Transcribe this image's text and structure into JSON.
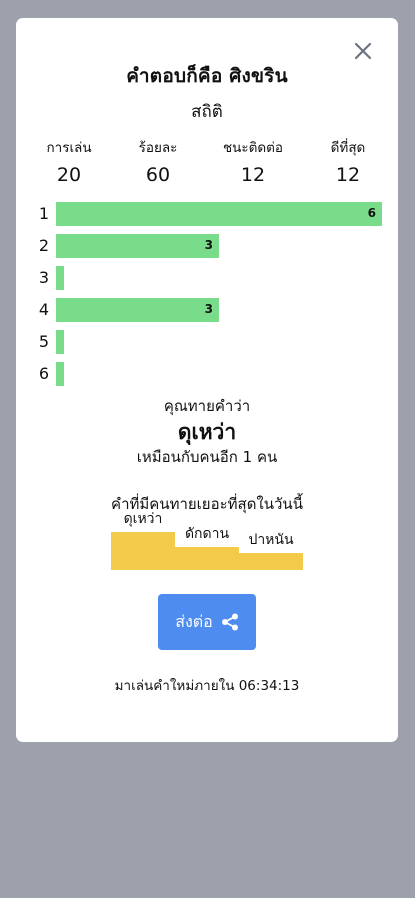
{
  "modal": {
    "title": "คำตอบก็คือ ศิงขริน",
    "subtitle": "สถิติ"
  },
  "stats": [
    {
      "label": "การเล่น",
      "value": "20"
    },
    {
      "label": "ร้อยละ",
      "value": "60"
    },
    {
      "label": "ชนะติดต่อ",
      "value": "12"
    },
    {
      "label": "ดีที่สุด",
      "value": "12"
    }
  ],
  "distribution": [
    {
      "guess": "1",
      "count": "6",
      "fraction": 1.0
    },
    {
      "guess": "2",
      "count": "3",
      "fraction": 0.5
    },
    {
      "guess": "3",
      "count": "",
      "fraction": 0.0
    },
    {
      "guess": "4",
      "count": "3",
      "fraction": 0.5
    },
    {
      "guess": "5",
      "count": "",
      "fraction": 0.0
    },
    {
      "guess": "6",
      "count": "",
      "fraction": 0.0
    }
  ],
  "guess": {
    "label": "คุณทายคำว่า",
    "word": "ดุเหว่า",
    "same_as": "เหมือนกับคนอีก 1 คน"
  },
  "popular": {
    "title": "คำที่มีคนทายเยอะที่สุดในวันนี้",
    "words": [
      {
        "word": "ดุเหว่า",
        "level": 1.0
      },
      {
        "word": "ดักดาน",
        "level": 0.6
      },
      {
        "word": "ปาหนัน",
        "level": 0.45
      }
    ]
  },
  "share": {
    "label": "ส่งต่อ",
    "icon": "share-icon"
  },
  "next_game": {
    "text": "มาเล่นคำใหม่ภายใน 06:34:13"
  },
  "colors": {
    "backdrop": "#9da1ab",
    "bar_green": "#79dc8b",
    "bar_yellow": "#f3ca49",
    "share_blue": "#4f8cf0"
  }
}
